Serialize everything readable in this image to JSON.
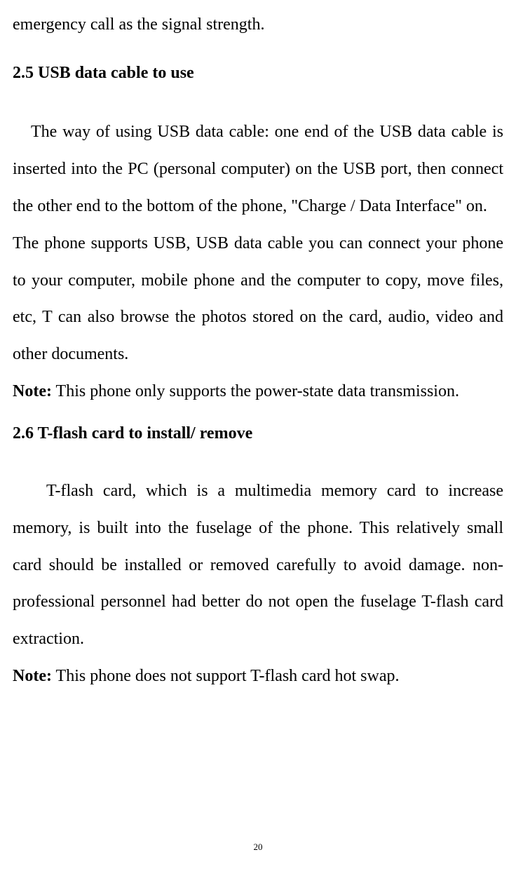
{
  "fragment_top": "emergency call as the signal strength.",
  "section25": {
    "heading": "2.5 USB data cable to use",
    "para1_indent": "The way of using USB data cable: one end of the USB data cable is inserted into the PC (personal computer) on the USB port, then connect the other end to the bottom of the phone, \"Charge / Data Interface\" on.",
    "para2": "The phone supports USB, USB data cable you can connect your phone to your computer, mobile phone and the computer to copy, move files, etc, T can also browse the photos stored on the card, audio, video and other documents.",
    "note_label": "Note:",
    "note_text": " This phone only supports the power-state data transmission."
  },
  "section26": {
    "heading": "2.6 T-flash card to install/ remove",
    "para1": "T-flash card, which is a multimedia memory card to increase memory, is built into the fuselage of the phone. This relatively small card should be installed or removed carefully to avoid damage. non-professional personnel had better do not open the fuselage T-flash card extraction.",
    "note_label": "Note:",
    "note_text": " This phone does not support T-flash card hot swap."
  },
  "page_number": "20"
}
